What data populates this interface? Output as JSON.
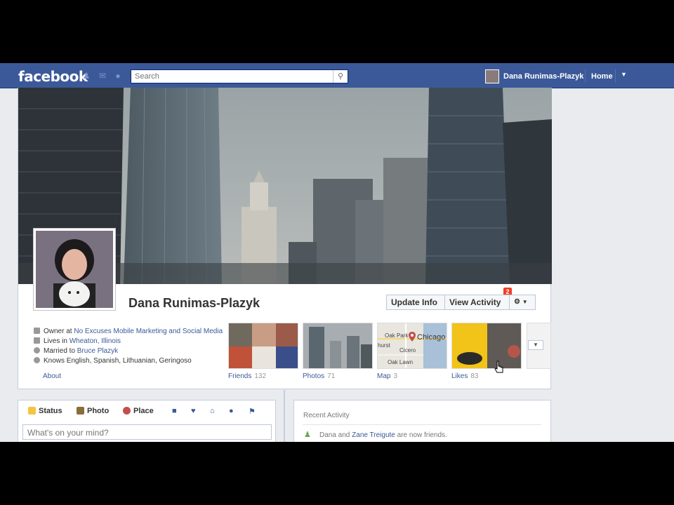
{
  "topbar": {
    "logo": "facebook",
    "search_placeholder": "Search",
    "user_name": "Dana Runimas-Plazyk",
    "home_label": "Home"
  },
  "profile": {
    "name": "Dana Runimas-Plazyk",
    "update_info_label": "Update Info",
    "view_activity_label": "View Activity",
    "activity_badge": "2"
  },
  "info": {
    "owner_prefix": "Owner at ",
    "owner_company": "No Excuses Mobile Marketing and Social Media",
    "lives_prefix": "Lives in ",
    "lives_place": "Wheaton, Illinois",
    "married_prefix": "Married to ",
    "married_name": "Bruce Plazyk",
    "knows": "Knows English, Spanish, Lithuanian, Geringoso",
    "about_label": "About"
  },
  "tiles": {
    "friends": {
      "label": "Friends",
      "count": "132"
    },
    "photos": {
      "label": "Photos",
      "count": "71"
    },
    "map": {
      "label": "Map",
      "count": "3",
      "city": "Chicago",
      "place1": "Oak Park",
      "place2": "Cicero",
      "place3": "Oak Lawn",
      "place4": "hurst"
    },
    "likes": {
      "label": "Likes",
      "count": "83"
    }
  },
  "composer": {
    "status_label": "Status",
    "photo_label": "Photo",
    "place_label": "Place",
    "placeholder": "What's on your mind?"
  },
  "activity": {
    "title": "Recent Activity",
    "item_prefix": "Dana and ",
    "item_friend": "Zane Treigute",
    "item_suffix": " are now friends."
  },
  "colors": {
    "brand": "#3b5998",
    "badge": "#f03d25"
  }
}
